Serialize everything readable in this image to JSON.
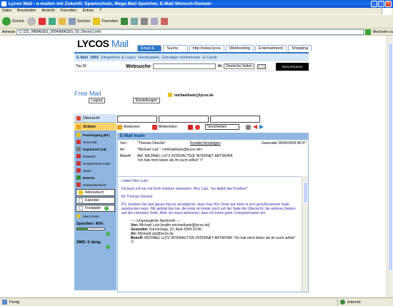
{
  "window": {
    "title": "Lycos Mail - e-mailen mit Zukunft: Spamschutz, Mega Mail Speicher, E-Mail Wunsch-Domain"
  },
  "menu": [
    "Datei",
    "Bearbeiten",
    "Ansicht",
    "Favoriten",
    "Extras",
    "?"
  ],
  "toolbar": {
    "back": "Zurück",
    "search": "Suchen",
    "favorites": "Favoriten"
  },
  "address": {
    "label": "Adresse",
    "value": "C:\\131_IMMAGES_2004\\IMAGES_03_Diecke1.mht",
    "go": "Wechseln zu"
  },
  "lycos": {
    "logo_main": "LYCOS",
    "logo_mail": "Mail",
    "tabs": [
      "Email & SMS",
      "Suche",
      "http://www.lycos",
      "Webhosting",
      "Entertainment",
      "Shopping"
    ],
    "subnav": [
      "E-Mail",
      "SMS",
      "Klingeltöne & Logos",
      "Handyspiele",
      "Günstiger telefonieren",
      "E-Cards"
    ]
  },
  "searchbar": {
    "top": "Top 50",
    "label": "Websuche",
    "in": "in",
    "scope": "Deutsche Seiten",
    "sponsor": "Sony Ericsson"
  },
  "freemail": {
    "title": "Free Mail",
    "logout": "Logout",
    "settings": "Einstellungen",
    "user": "michaelluetz@lycos.de"
  },
  "leftnav": {
    "overview": "Übersicht",
    "folders": "Ordner",
    "folder_items": [
      "Posteingang (8/1)",
      "Gesendet",
      "Papierkorb (19)",
      "Entwürfe",
      "Gespeicherte mails",
      "Spam",
      "Externe",
      "Ordnerübersicht"
    ],
    "addressbook": "Adressbuch",
    "calendar": "Kalender",
    "harddisk": "Festplatte",
    "account": "Mein Konto",
    "storage_label": "Speicher: 40%",
    "storage_percent": 40,
    "sms_label": "SMS: 0 übrig"
  },
  "actions": {
    "reply": "Antworten",
    "forward": "Weiterleiten",
    "move": "Verschieben"
  },
  "email": {
    "section_title": "E-Mail lesen",
    "from_label": "Von :",
    "from_value": "\"Thomas Deecke\"",
    "add_contact": "Kontakt hinzufügen",
    "date": "Gesendet 26/04/2004 08:37",
    "to_label": "An :",
    "to_value": "\"Michael Lutz \" <michaelluetz@lycos.de>",
    "subject_label": "Betreff",
    "subject_value": "AW: MICHAEL LUTZ INTERACTIVE INTERNET ARTWORK \"ich hab mich lieber als ihr euch selbst\" !!!",
    "body": [
      "Lieber Herr Lutz!",
      "Da kann ich nur mit Erich Kästner antworten: Herr Lutz, \"wo bleibt das Positive!\"",
      "Ihr Thomas Deecke",
      "PS. könnten Sie das ganze mal so arrangieren, dass man Ihre Texte auf einer in sich geschlossenen Seite ausdrucken kann: Mir gelingt das nie, die erste ist immer noch auf der Seite der Übersicht, die anderen beiden auf den nächsten Seite. Aber ich muss bekennen, dass ich keine guter Computernutzer bin."
    ],
    "original_header": "-----Ursprüngliche Nachricht-----",
    "original": [
      {
        "k": "Von:",
        "v": "Michael Lutz [mailto:michaelluetz@lycos.de]"
      },
      {
        "k": "Gesendet:",
        "v": "Donnerstag, 22. April 2004 22:49"
      },
      {
        "k": "An:",
        "v": "MichaelLutz@lycos.de"
      },
      {
        "k": "Betreff:",
        "v": "MICHAEL LUTZ INTERACTIVE INTERNET ARTWORK \"ich hab mich lieber als ihr euch selbst\" !!!"
      }
    ]
  },
  "status": {
    "left": "Fertig",
    "zone": "Internet"
  }
}
